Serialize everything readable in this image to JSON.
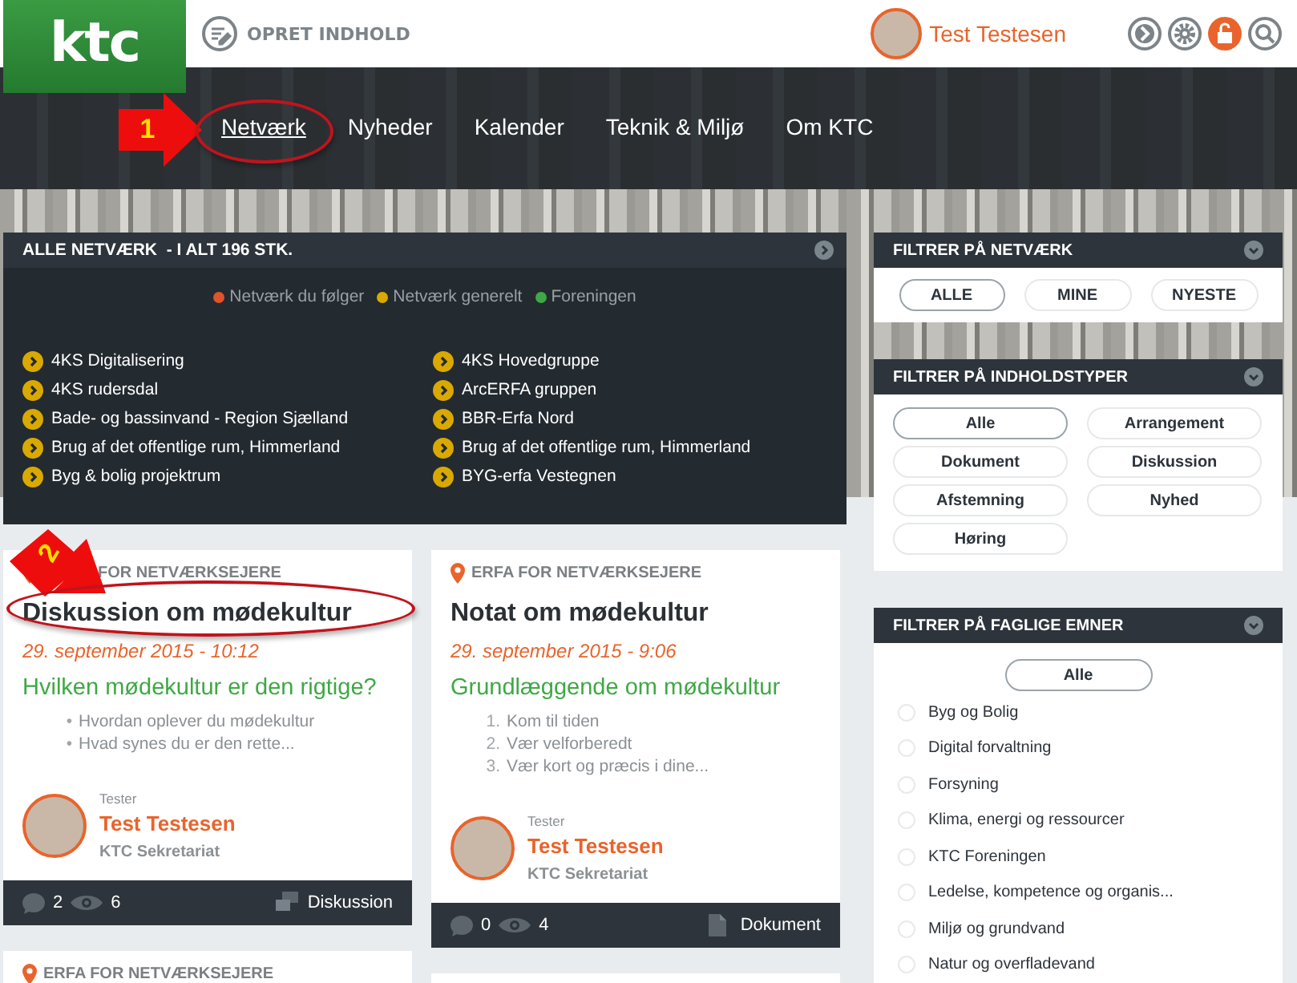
{
  "header": {
    "logo": "ktc",
    "create_label": "OPRET INDHOLD",
    "user_name": "Test Testesen"
  },
  "nav": [
    {
      "label": "Netværk",
      "selected": true
    },
    {
      "label": "Nyheder",
      "selected": false
    },
    {
      "label": "Kalender",
      "selected": false
    },
    {
      "label": "Teknik & Miljø",
      "selected": false
    },
    {
      "label": "Om KTC",
      "selected": false
    }
  ],
  "network_panel": {
    "title": "ALLE NETVÆRK  - I ALT 196 STK.",
    "legend": [
      {
        "label": "Netværk du følger",
        "color": "#e0532b"
      },
      {
        "label": "Netværk generelt",
        "color": "#d9a900"
      },
      {
        "label": "Foreningen",
        "color": "#3fa845"
      }
    ],
    "items": [
      {
        "label": "4KS Digitalisering",
        "color": "#d9a900"
      },
      {
        "label": "4KS Hovedgruppe",
        "color": "#d9a900"
      },
      {
        "label": "4KS rudersdal",
        "color": "#d9a900"
      },
      {
        "label": "ArcERFA gruppen",
        "color": "#d9a900"
      },
      {
        "label": "Bade- og bassinvand - Region Sjælland",
        "color": "#d9a900"
      },
      {
        "label": "BBR-Erfa Nord",
        "color": "#d9a900"
      },
      {
        "label": "Brug af det offentlige rum, Himmerland",
        "color": "#d9a900"
      },
      {
        "label": "Brug af det offentlige rum, Himmerland",
        "color": "#d9a900"
      },
      {
        "label": "Byg & bolig projektrum",
        "color": "#d9a900"
      },
      {
        "label": "BYG-erfa Vestegnen",
        "color": "#d9a900"
      }
    ]
  },
  "post_columns": [
    [
      {
        "category": "FOR NETVÆRKSEJERE",
        "title": "Diskussion om mødekultur",
        "date": "29. september 2015 - 10:12",
        "subtitle": "Hvilken mødekultur er den rigtige?",
        "list": [
          {
            "marker": "•",
            "text": "Hvordan oplever du mødekultur"
          },
          {
            "marker": "•",
            "text": "Hvad synes du er den rette..."
          }
        ],
        "author_role": "Tester",
        "author_name": "Test Testesen",
        "author_org": "KTC Sekretariat",
        "comments": "2",
        "views": "6",
        "content_type": {
          "kind": "discussion",
          "label": "Diskussion"
        }
      },
      {
        "category": "ERFA FOR NETVÆRKSEJERE"
      }
    ],
    [
      {
        "category": "ERFA FOR NETVÆRKSEJERE",
        "title": "Notat om mødekultur",
        "date": "29. september 2015 - 9:06",
        "subtitle": "Grundlæggende om mødekultur",
        "list": [
          {
            "marker": "1.",
            "text": "Kom til tiden"
          },
          {
            "marker": "2.",
            "text": "Vær velforberedt"
          },
          {
            "marker": "3.",
            "text": "Vær kort og præcis i dine..."
          }
        ],
        "author_role": "Tester",
        "author_name": "Test Testesen",
        "author_org": "KTC Sekretariat",
        "comments": "0",
        "views": "4",
        "content_type": {
          "kind": "document",
          "label": "Dokument"
        }
      },
      {}
    ]
  ],
  "network_filter": {
    "title": "FILTRER PÅ NETVÆRK",
    "options": [
      {
        "label": "ALLE",
        "selected": true
      },
      {
        "label": "MINE",
        "selected": false
      },
      {
        "label": "NYESTE",
        "selected": false
      }
    ]
  },
  "type_filter": {
    "title": "FILTRER PÅ INDHOLDSTYPER",
    "options": [
      {
        "label": "Alle",
        "selected": true
      },
      {
        "label": "Arrangement",
        "selected": false
      },
      {
        "label": "Dokument",
        "selected": false
      },
      {
        "label": "Diskussion",
        "selected": false
      },
      {
        "label": "Afstemning",
        "selected": false
      },
      {
        "label": "Nyhed",
        "selected": false
      },
      {
        "label": "Høring",
        "selected": false
      }
    ]
  },
  "topic_filter": {
    "title": "FILTRER PÅ FAGLIGE EMNER",
    "all_button": {
      "label": "Alle",
      "selected": true
    },
    "topics": [
      {
        "label": "Byg og Bolig",
        "checked": false
      },
      {
        "label": "Digital forvaltning",
        "checked": false
      },
      {
        "label": "Forsyning",
        "checked": false
      },
      {
        "label": "Klima, energi og ressourcer",
        "checked": false
      },
      {
        "label": "KTC Foreningen",
        "checked": false
      },
      {
        "label": "Ledelse, kompetence og organis...",
        "checked": false
      },
      {
        "label": "Miljø og grundvand",
        "checked": false
      },
      {
        "label": "Natur og overfladevand",
        "checked": false
      }
    ]
  },
  "annotations": [
    {
      "label": "1"
    },
    {
      "label": "2"
    }
  ]
}
